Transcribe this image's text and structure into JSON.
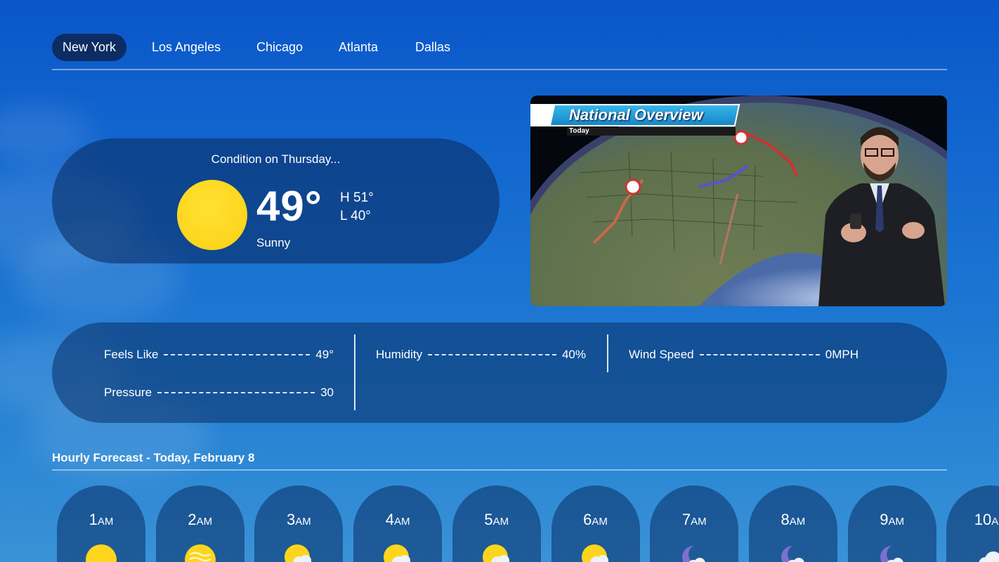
{
  "tabs": [
    {
      "label": "New York",
      "active": true
    },
    {
      "label": "Los Angeles",
      "active": false
    },
    {
      "label": "Chicago",
      "active": false
    },
    {
      "label": "Atlanta",
      "active": false
    },
    {
      "label": "Dallas",
      "active": false
    }
  ],
  "condition": {
    "title": "Condition on Thursday...",
    "temp": "49°",
    "high": "H 51°",
    "low": "L 40°",
    "text": "Sunny",
    "icon": "sun-icon"
  },
  "video": {
    "banner": "National Overview",
    "subtitle": "Today"
  },
  "details": {
    "feels_like": {
      "label": "Feels Like",
      "value": "49°"
    },
    "pressure": {
      "label": "Pressure",
      "value": "30"
    },
    "humidity": {
      "label": "Humidity",
      "value": "40%"
    },
    "wind_speed": {
      "label": "Wind Speed",
      "value": "0MPH"
    }
  },
  "hourly": {
    "title": "Hourly Forecast - Today, February 8",
    "items": [
      {
        "hour": "1",
        "ampm": "AM",
        "icon": "sun-icon"
      },
      {
        "hour": "2",
        "ampm": "AM",
        "icon": "sun-haze-icon"
      },
      {
        "hour": "3",
        "ampm": "AM",
        "icon": "partly-cloudy-icon"
      },
      {
        "hour": "4",
        "ampm": "AM",
        "icon": "partly-cloudy-icon"
      },
      {
        "hour": "5",
        "ampm": "AM",
        "icon": "partly-cloudy-icon"
      },
      {
        "hour": "6",
        "ampm": "AM",
        "icon": "partly-cloudy-icon"
      },
      {
        "hour": "7",
        "ampm": "AM",
        "icon": "moon-cloud-icon"
      },
      {
        "hour": "8",
        "ampm": "AM",
        "icon": "moon-cloud-icon"
      },
      {
        "hour": "9",
        "ampm": "AM",
        "icon": "moon-cloud-icon"
      },
      {
        "hour": "10",
        "ampm": "AM",
        "icon": "cloud-icon"
      }
    ]
  },
  "colors": {
    "active_tab": "#0d2c63",
    "card": "#0a2d64",
    "sun": "#fdd51c",
    "moon": "#7d6fd0",
    "banner": "#1587c6"
  }
}
